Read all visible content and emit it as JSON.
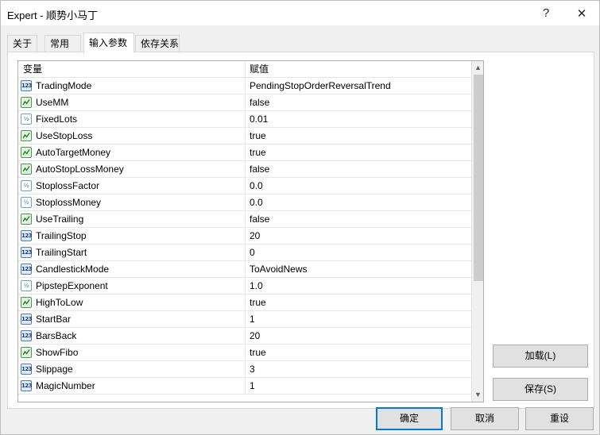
{
  "window": {
    "title": "Expert - 顺势小马丁",
    "help_glyph": "?",
    "close_glyph": "✕"
  },
  "tabs": [
    {
      "label": "关于",
      "active": false
    },
    {
      "label": "常用",
      "active": false
    },
    {
      "label": "输入参数",
      "active": true
    },
    {
      "label": "依存关系",
      "active": false
    }
  ],
  "grid": {
    "col_name": "变量",
    "col_value": "赋值",
    "rows": [
      {
        "icon": "int-icon",
        "name": "TradingMode",
        "value": "PendingStopOrderReversalTrend"
      },
      {
        "icon": "bool-icon",
        "name": "UseMM",
        "value": "false"
      },
      {
        "icon": "double-icon",
        "name": "FixedLots",
        "value": "0.01"
      },
      {
        "icon": "bool-icon",
        "name": "UseStopLoss",
        "value": "true"
      },
      {
        "icon": "bool-icon",
        "name": "AutoTargetMoney",
        "value": "true"
      },
      {
        "icon": "bool-icon",
        "name": "AutoStopLossMoney",
        "value": "false"
      },
      {
        "icon": "double-icon",
        "name": "StoplossFactor",
        "value": "0.0"
      },
      {
        "icon": "double-icon",
        "name": "StoplossMoney",
        "value": "0.0"
      },
      {
        "icon": "bool-icon",
        "name": "UseTrailing",
        "value": "false"
      },
      {
        "icon": "int-icon",
        "name": "TrailingStop",
        "value": "20"
      },
      {
        "icon": "int-icon",
        "name": "TrailingStart",
        "value": "0"
      },
      {
        "icon": "int-icon",
        "name": "CandlestickMode",
        "value": "ToAvoidNews"
      },
      {
        "icon": "double-icon",
        "name": "PipstepExponent",
        "value": "1.0"
      },
      {
        "icon": "bool-icon",
        "name": "HighToLow",
        "value": "true"
      },
      {
        "icon": "int-icon",
        "name": "StartBar",
        "value": "1"
      },
      {
        "icon": "int-icon",
        "name": "BarsBack",
        "value": "20"
      },
      {
        "icon": "bool-icon",
        "name": "ShowFibo",
        "value": "true"
      },
      {
        "icon": "int-icon",
        "name": "Slippage",
        "value": "3"
      },
      {
        "icon": "int-icon",
        "name": "MagicNumber",
        "value": "1"
      }
    ]
  },
  "icon_text": {
    "int": "123",
    "double": "½"
  },
  "buttons": {
    "load": "加载(L)",
    "save": "保存(S)",
    "ok": "确定",
    "cancel": "取消",
    "reset": "重设"
  },
  "colors": {
    "accent": "#0078d7",
    "button_face": "#e1e1e1",
    "window_bg": "#f0f0f0"
  }
}
